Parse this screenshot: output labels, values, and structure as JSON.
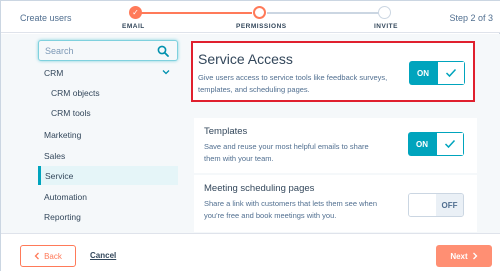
{
  "header": {
    "title": "Create users",
    "step_counter": "Step 2 of 3",
    "steps": [
      {
        "label": "EMAIL",
        "state": "complete",
        "check": "✓"
      },
      {
        "label": "PERMISSIONS",
        "state": "current"
      },
      {
        "label": "INVITE",
        "state": "upcoming"
      }
    ]
  },
  "sidebar": {
    "search_placeholder": "Search",
    "items": [
      {
        "label": "CRM"
      },
      {
        "label": "CRM objects"
      },
      {
        "label": "CRM tools"
      },
      {
        "label": "Marketing"
      },
      {
        "label": "Sales"
      },
      {
        "label": "Service"
      },
      {
        "label": "Automation"
      },
      {
        "label": "Reporting"
      }
    ]
  },
  "main": {
    "service_access": {
      "title": "Service Access",
      "description": "Give users access to service tools like feedback surveys, templates, and scheduling pages.",
      "toggle_label": "ON",
      "enabled": true
    },
    "templates": {
      "title": "Templates",
      "description": "Save and reuse your most helpful emails to share them with your team.",
      "toggle_label": "ON",
      "enabled": true
    },
    "meetings": {
      "title": "Meeting scheduling pages",
      "description": "Share a link with customers that lets them see when you're free and book meetings with you.",
      "toggle_label": "OFF",
      "enabled": false
    }
  },
  "footer": {
    "back_label": "Back",
    "cancel_label": "Cancel",
    "next_label": "Next"
  },
  "colors": {
    "accent": "#ff7a59",
    "toggle_on": "#00a4bd",
    "highlight_border": "#e0202e"
  },
  "icons": [
    "check-icon",
    "search-icon",
    "chevron-down-icon",
    "chevron-left-icon",
    "chevron-right-icon"
  ]
}
